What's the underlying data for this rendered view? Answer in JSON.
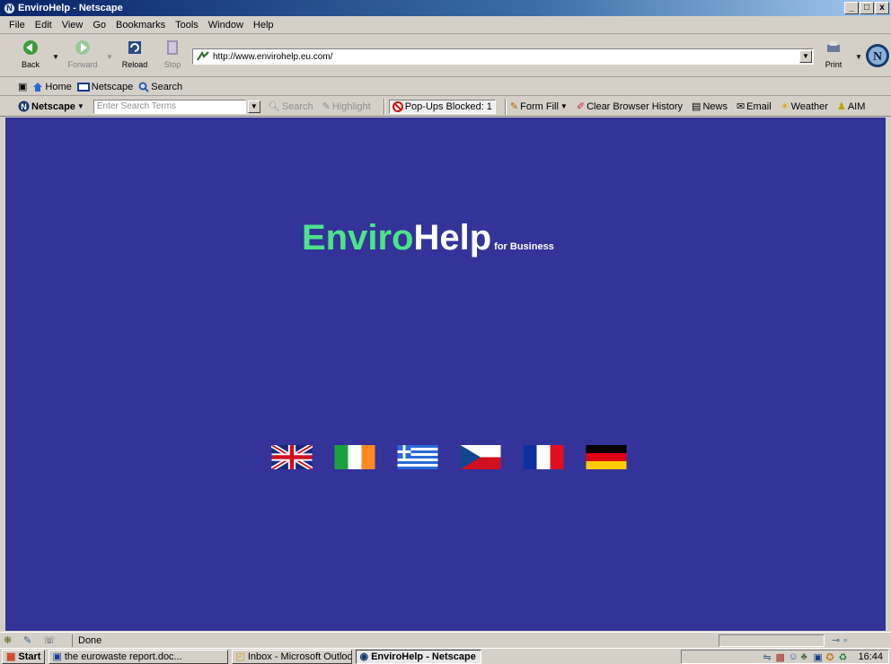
{
  "window": {
    "title": "EnviroHelp - Netscape",
    "buttons": [
      "_",
      "8",
      "X"
    ]
  },
  "menu": [
    "File",
    "Edit",
    "View",
    "Go",
    "Bookmarks",
    "Tools",
    "Window",
    "Help"
  ],
  "nav": {
    "back": "Back",
    "forward": "Forward",
    "reload": "Reload",
    "stop": "Stop",
    "print": "Print",
    "url": "http://www.envirohelp.eu.com/"
  },
  "personal": {
    "home": "Home",
    "netscape": "Netscape",
    "search": "Search"
  },
  "searchbar": {
    "brand": "Netscape",
    "placeholder": "Enter Search Terms",
    "search": "Search",
    "highlight": "Highlight",
    "popups": "Pop-Ups Blocked: 1",
    "formfill": "Form Fill",
    "clear": "Clear Browser History",
    "news": "News",
    "email": "Email",
    "weather": "Weather",
    "aim": "AIM"
  },
  "page": {
    "logo_a": "Enviro",
    "logo_b": "Help",
    "logo_c": "for Business",
    "bg": "#333399",
    "flags": [
      "uk",
      "ireland",
      "greece",
      "czech",
      "france",
      "germany"
    ]
  },
  "status": {
    "text": "Done"
  },
  "taskbar": {
    "start": "Start",
    "tasks": [
      "the eurowaste report.doc...",
      "Inbox - Microsoft Outlook",
      "EnviroHelp - Netscape"
    ],
    "clock": "16:44"
  }
}
